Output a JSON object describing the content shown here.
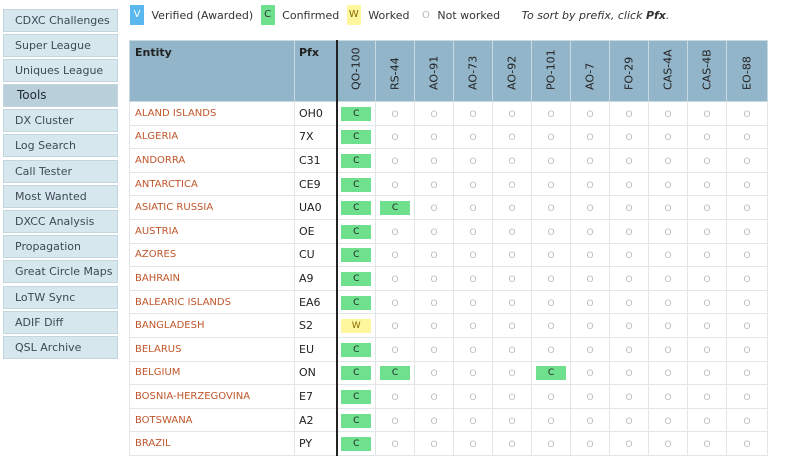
{
  "sidebar": {
    "items": [
      {
        "label": "CDXC Challenges",
        "active": false
      },
      {
        "label": "Super League",
        "active": false
      },
      {
        "label": "Uniques League",
        "active": false
      },
      {
        "label": "Tools",
        "active": true
      },
      {
        "label": "DX Cluster",
        "active": false
      },
      {
        "label": "Log Search",
        "active": false
      },
      {
        "label": "Call Tester",
        "active": false
      },
      {
        "label": "Most Wanted",
        "active": false
      },
      {
        "label": "DXCC Analysis",
        "active": false
      },
      {
        "label": "Propagation",
        "active": false
      },
      {
        "label": "Great Circle Maps",
        "active": false
      },
      {
        "label": "LoTW Sync",
        "active": false
      },
      {
        "label": "ADIF Diff",
        "active": false
      },
      {
        "label": "QSL Archive",
        "active": false
      }
    ]
  },
  "legend": {
    "verified_badge": "V",
    "verified_text": "Verified (Awarded)",
    "confirmed_badge": "C",
    "confirmed_text": "Confirmed",
    "worked_badge": "W",
    "worked_text": "Worked",
    "not_worked_badge": "O",
    "not_worked_text": "Not worked",
    "note_prefix": "To sort by prefix, click ",
    "note_link": "Pfx",
    "note_suffix": ".",
    "colors": {
      "verified": "#5bb8ee",
      "confirmed": "#6ee08e",
      "worked": "#fff79e"
    }
  },
  "table": {
    "entity_header": "Entity",
    "pfx_header": "Pfx",
    "satellites": [
      "QO-100",
      "RS-44",
      "AO-91",
      "AO-73",
      "AO-92",
      "PO-101",
      "AO-7",
      "FO-29",
      "CAS-4A",
      "CAS-4B",
      "EO-88"
    ],
    "not_worked_glyph": "O",
    "rows": [
      {
        "entity": "ALAND ISLANDS",
        "pfx": "OH0",
        "status": [
          "C",
          "O",
          "O",
          "O",
          "O",
          "O",
          "O",
          "O",
          "O",
          "O",
          "O"
        ]
      },
      {
        "entity": "ALGERIA",
        "pfx": "7X",
        "status": [
          "C",
          "O",
          "O",
          "O",
          "O",
          "O",
          "O",
          "O",
          "O",
          "O",
          "O"
        ]
      },
      {
        "entity": "ANDORRA",
        "pfx": "C31",
        "status": [
          "C",
          "O",
          "O",
          "O",
          "O",
          "O",
          "O",
          "O",
          "O",
          "O",
          "O"
        ]
      },
      {
        "entity": "ANTARCTICA",
        "pfx": "CE9",
        "status": [
          "C",
          "O",
          "O",
          "O",
          "O",
          "O",
          "O",
          "O",
          "O",
          "O",
          "O"
        ]
      },
      {
        "entity": "ASIATIC RUSSIA",
        "pfx": "UA0",
        "status": [
          "C",
          "C",
          "O",
          "O",
          "O",
          "O",
          "O",
          "O",
          "O",
          "O",
          "O"
        ]
      },
      {
        "entity": "AUSTRIA",
        "pfx": "OE",
        "status": [
          "C",
          "O",
          "O",
          "O",
          "O",
          "O",
          "O",
          "O",
          "O",
          "O",
          "O"
        ]
      },
      {
        "entity": "AZORES",
        "pfx": "CU",
        "status": [
          "C",
          "O",
          "O",
          "O",
          "O",
          "O",
          "O",
          "O",
          "O",
          "O",
          "O"
        ]
      },
      {
        "entity": "BAHRAIN",
        "pfx": "A9",
        "status": [
          "C",
          "O",
          "O",
          "O",
          "O",
          "O",
          "O",
          "O",
          "O",
          "O",
          "O"
        ]
      },
      {
        "entity": "BALEARIC ISLANDS",
        "pfx": "EA6",
        "status": [
          "C",
          "O",
          "O",
          "O",
          "O",
          "O",
          "O",
          "O",
          "O",
          "O",
          "O"
        ]
      },
      {
        "entity": "BANGLADESH",
        "pfx": "S2",
        "status": [
          "W",
          "O",
          "O",
          "O",
          "O",
          "O",
          "O",
          "O",
          "O",
          "O",
          "O"
        ]
      },
      {
        "entity": "BELARUS",
        "pfx": "EU",
        "status": [
          "C",
          "O",
          "O",
          "O",
          "O",
          "O",
          "O",
          "O",
          "O",
          "O",
          "O"
        ]
      },
      {
        "entity": "BELGIUM",
        "pfx": "ON",
        "status": [
          "C",
          "C",
          "O",
          "O",
          "O",
          "C",
          "O",
          "O",
          "O",
          "O",
          "O"
        ]
      },
      {
        "entity": "BOSNIA-HERZEGOVINA",
        "pfx": "E7",
        "status": [
          "C",
          "O",
          "O",
          "O",
          "O",
          "O",
          "O",
          "O",
          "O",
          "O",
          "O"
        ]
      },
      {
        "entity": "BOTSWANA",
        "pfx": "A2",
        "status": [
          "C",
          "O",
          "O",
          "O",
          "O",
          "O",
          "O",
          "O",
          "O",
          "O",
          "O"
        ]
      },
      {
        "entity": "BRAZIL",
        "pfx": "PY",
        "status": [
          "C",
          "O",
          "O",
          "O",
          "O",
          "O",
          "O",
          "O",
          "O",
          "O",
          "O"
        ]
      }
    ]
  }
}
